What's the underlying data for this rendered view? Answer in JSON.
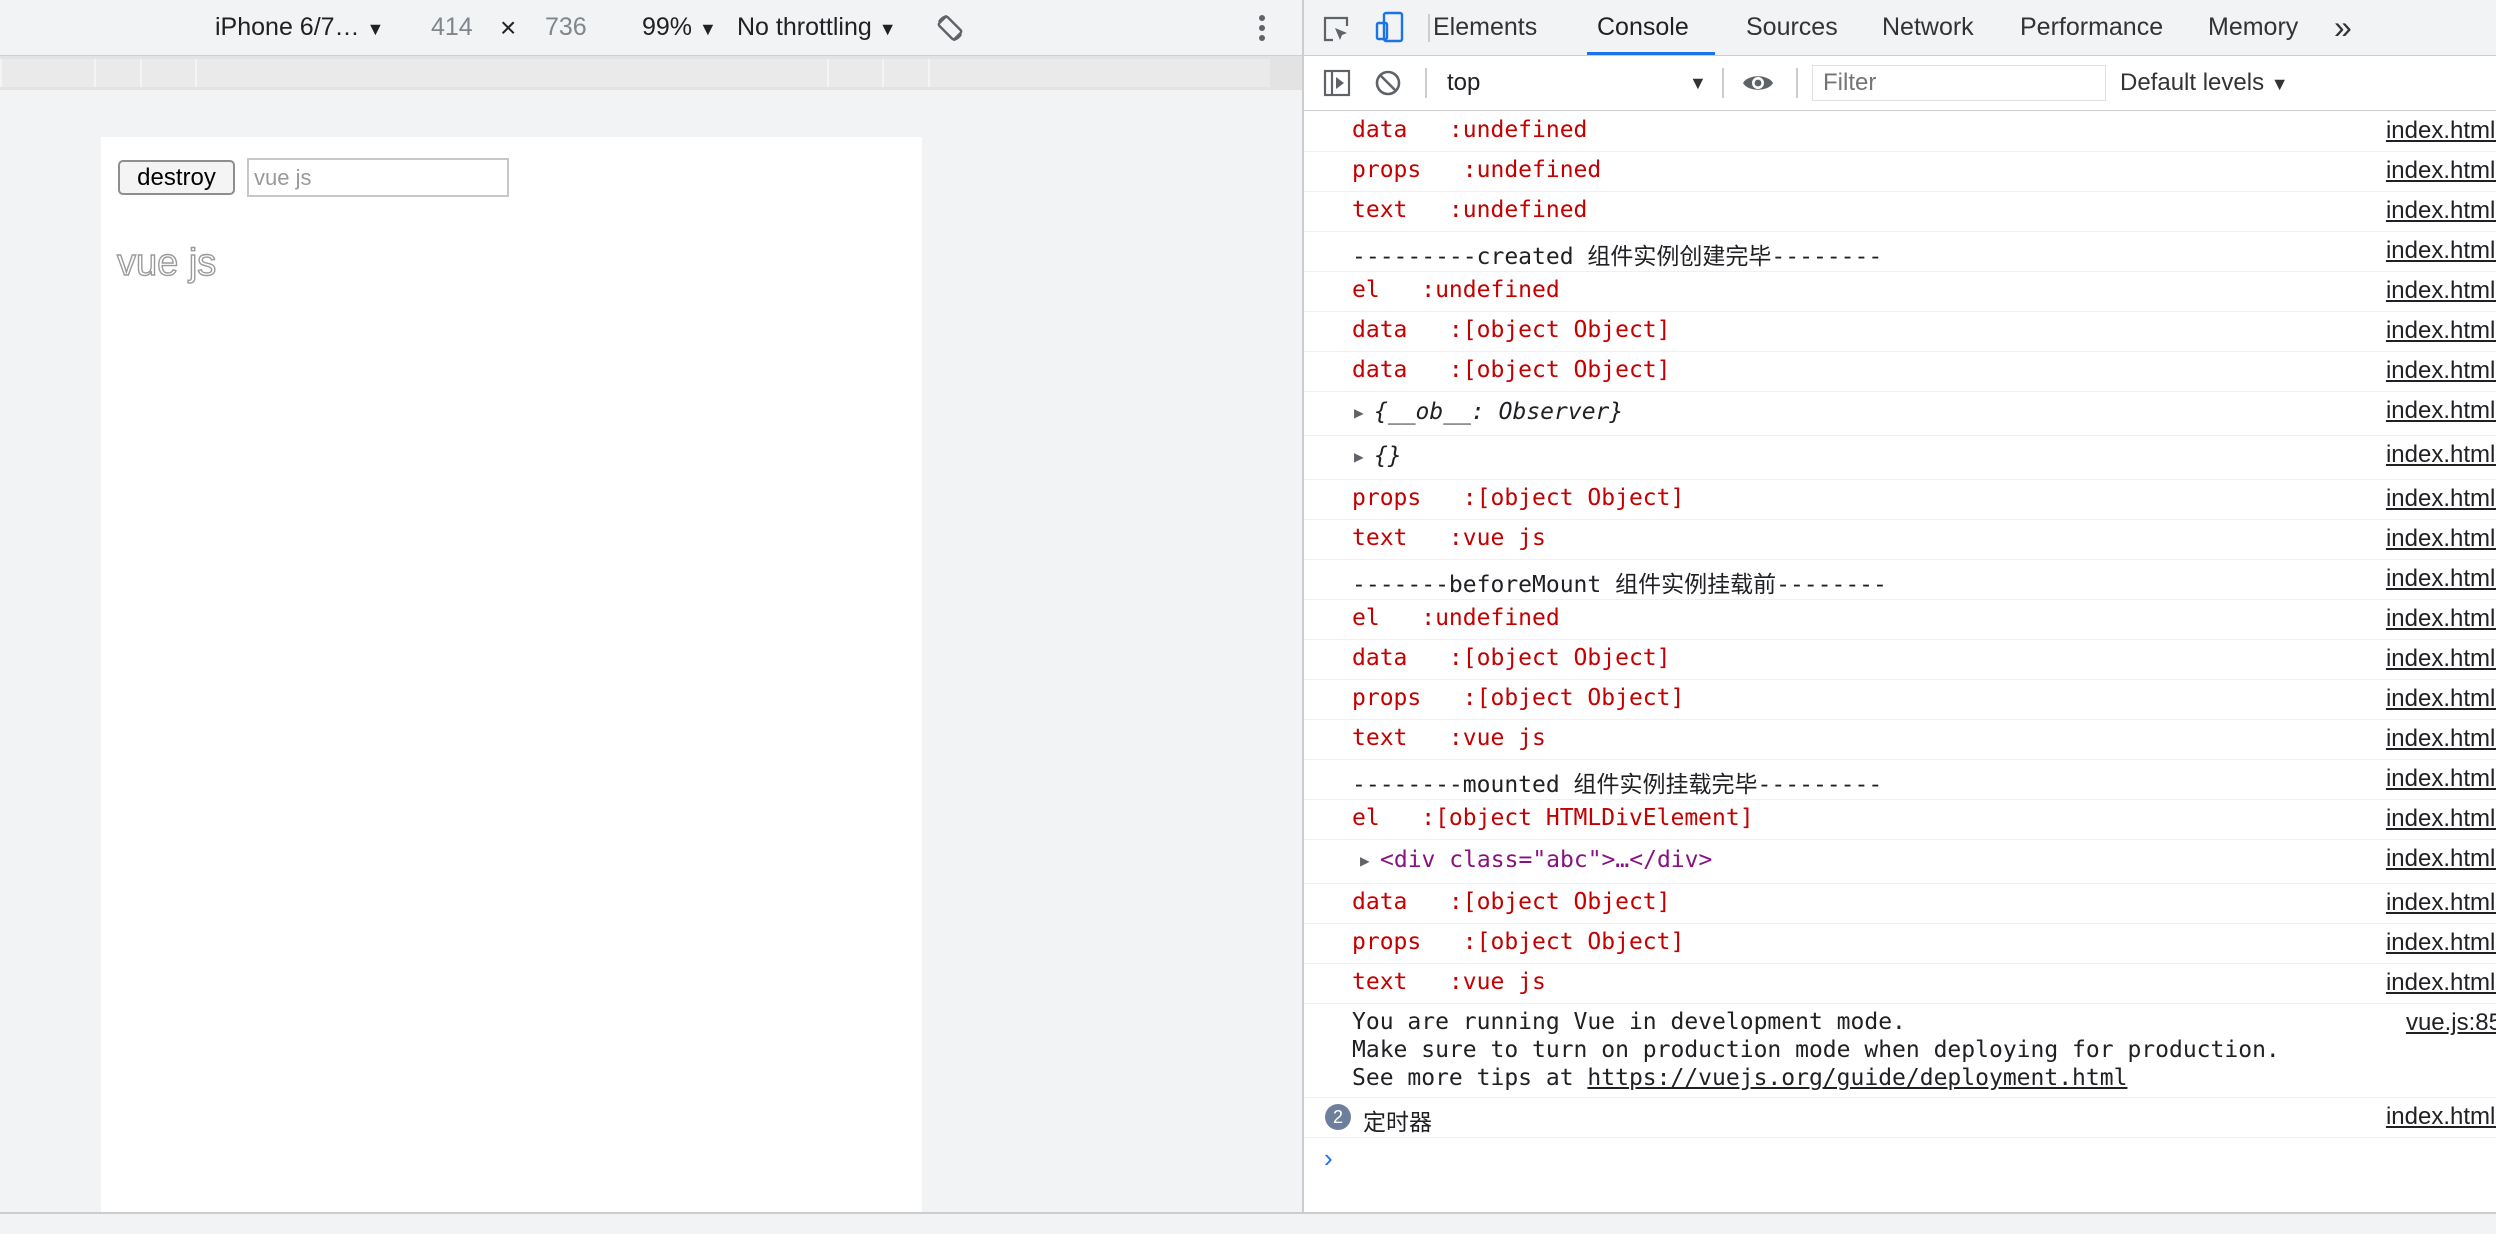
{
  "device_toolbar": {
    "device": "iPhone 6/7…",
    "width": "414",
    "times": "×",
    "height": "736",
    "zoom": "99%",
    "throttling": "No throttling"
  },
  "page": {
    "destroy_button": "destroy",
    "input_value": "vue js",
    "output_text": "vue js"
  },
  "devtools": {
    "tabs": [
      "Elements",
      "Console",
      "Sources",
      "Network",
      "Performance",
      "Memory"
    ],
    "more_tabs": "»",
    "active_tab": "Console",
    "context": "top",
    "filter_placeholder": "Filter",
    "levels": "Default levels"
  },
  "console": {
    "rows": [
      {
        "text": "data   :undefined",
        "kind": "error",
        "src": "index.html:"
      },
      {
        "text": "props   :undefined",
        "kind": "error",
        "src": "index.html:"
      },
      {
        "text": "text   :undefined",
        "kind": "error",
        "src": "index.html:"
      },
      {
        "text": "---------created 组件实例创建完毕--------",
        "kind": "log",
        "src": "index.html:"
      },
      {
        "text": "el   :undefined",
        "kind": "error",
        "src": "index.html:"
      },
      {
        "text": "data   :[object Object]",
        "kind": "error",
        "src": "index.html:"
      },
      {
        "text": "data   :[object Object]",
        "kind": "error",
        "src": "index.html:"
      },
      {
        "text": "{__ob__: Observer}",
        "kind": "object",
        "src": "index.html:"
      },
      {
        "text": "{}",
        "kind": "object",
        "src": "index.html:"
      },
      {
        "text": "props   :[object Object]",
        "kind": "error",
        "src": "index.html:"
      },
      {
        "text": "text   :vue js",
        "kind": "error",
        "src": "index.html:"
      },
      {
        "text": "-------beforeMount 组件实例挂载前--------",
        "kind": "log",
        "src": "index.html:"
      },
      {
        "text": "el   :undefined",
        "kind": "error",
        "src": "index.html:"
      },
      {
        "text": "data   :[object Object]",
        "kind": "error",
        "src": "index.html:"
      },
      {
        "text": "props   :[object Object]",
        "kind": "error",
        "src": "index.html:"
      },
      {
        "text": "text   :vue js",
        "kind": "error",
        "src": "index.html:"
      },
      {
        "text": "--------mounted 组件实例挂载完毕---------",
        "kind": "log",
        "src": "index.html:"
      },
      {
        "text": "el   :[object HTMLDivElement]",
        "kind": "error",
        "src": "index.html:"
      },
      {
        "text": "<div class=\"abc\">…</div>",
        "kind": "element",
        "src": "index.html:"
      },
      {
        "text": "data   :[object Object]",
        "kind": "error",
        "src": "index.html:"
      },
      {
        "text": "props   :[object Object]",
        "kind": "error",
        "src": "index.html:"
      },
      {
        "text": "text   :vue js",
        "kind": "error",
        "src": "index.html:"
      }
    ],
    "vue_notice": {
      "line1": "You are running Vue in development mode.",
      "line2": "Make sure to turn on production mode when deploying for production.",
      "line3_prefix": "See more tips at ",
      "line3_link": "https://vuejs.org/guide/deployment.html",
      "src": "vue.js:85"
    },
    "timer_row": {
      "count": "2",
      "text": "定时器",
      "src": "index.html:"
    },
    "prompt": "›"
  },
  "colors": {
    "error_text": "#c40000",
    "accent": "#1a73e8",
    "toolbar_bg": "#f1f3f4"
  }
}
